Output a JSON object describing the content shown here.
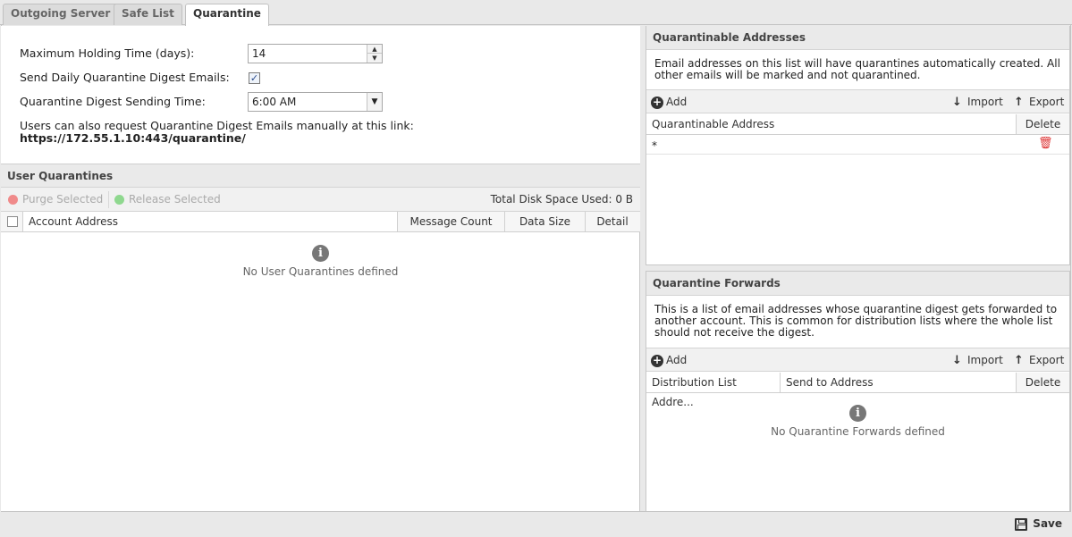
{
  "tabs": [
    {
      "label": "Outgoing Server"
    },
    {
      "label": "Safe List"
    },
    {
      "label": "Quarantine"
    }
  ],
  "settings": {
    "holding_time_label": "Maximum Holding Time (days):",
    "holding_time_value": "14",
    "digest_emails_label": "Send Daily Quarantine Digest Emails:",
    "digest_emails_checked": true,
    "digest_time_label": "Quarantine Digest Sending Time:",
    "digest_time_value": "6:00 AM",
    "link_note": "Users can also request Quarantine Digest Emails manually at this link:",
    "link_url": "https://172.55.1.10:443/quarantine/"
  },
  "user_quarantines": {
    "title": "User Quarantines",
    "purge_label": "Purge Selected",
    "release_label": "Release Selected",
    "disk_space": "Total Disk Space Used: 0 B",
    "columns": [
      "Account Address",
      "Message Count",
      "Data Size",
      "Detail"
    ],
    "empty_text": "No User Quarantines defined"
  },
  "quarantinable": {
    "title": "Quarantinable Addresses",
    "description_line1": "Email addresses on this list will have quarantines automatically created. All",
    "description_line2": "other emails will be marked and not quarantined.",
    "add_label": "Add",
    "import_label": "Import",
    "export_label": "Export",
    "columns": [
      "Quarantinable Address",
      "Delete"
    ],
    "rows": [
      {
        "address": "*"
      }
    ]
  },
  "forwards": {
    "title": "Quarantine Forwards",
    "description_line1": "This is a list of email addresses whose quarantine digest gets forwarded to",
    "description_line2": "another account. This is common for distribution lists where the whole list",
    "description_line3": "should not receive the digest.",
    "add_label": "Add",
    "import_label": "Import",
    "export_label": "Export",
    "columns": [
      "Distribution List Addre...",
      "Send to Address",
      "Delete"
    ],
    "empty_text": "No Quarantine Forwards defined"
  },
  "footer": {
    "save_label": "Save"
  },
  "icons": {
    "info": "info-icon",
    "trash": "trash-icon",
    "add": "plus-circle-icon",
    "import": "arrow-down-icon",
    "export": "arrow-up-icon",
    "save": "floppy-disk-icon"
  },
  "colors": {
    "trash": "#dd3333",
    "purge_dot": "#f08a8a",
    "release_dot": "#8fd88f"
  }
}
